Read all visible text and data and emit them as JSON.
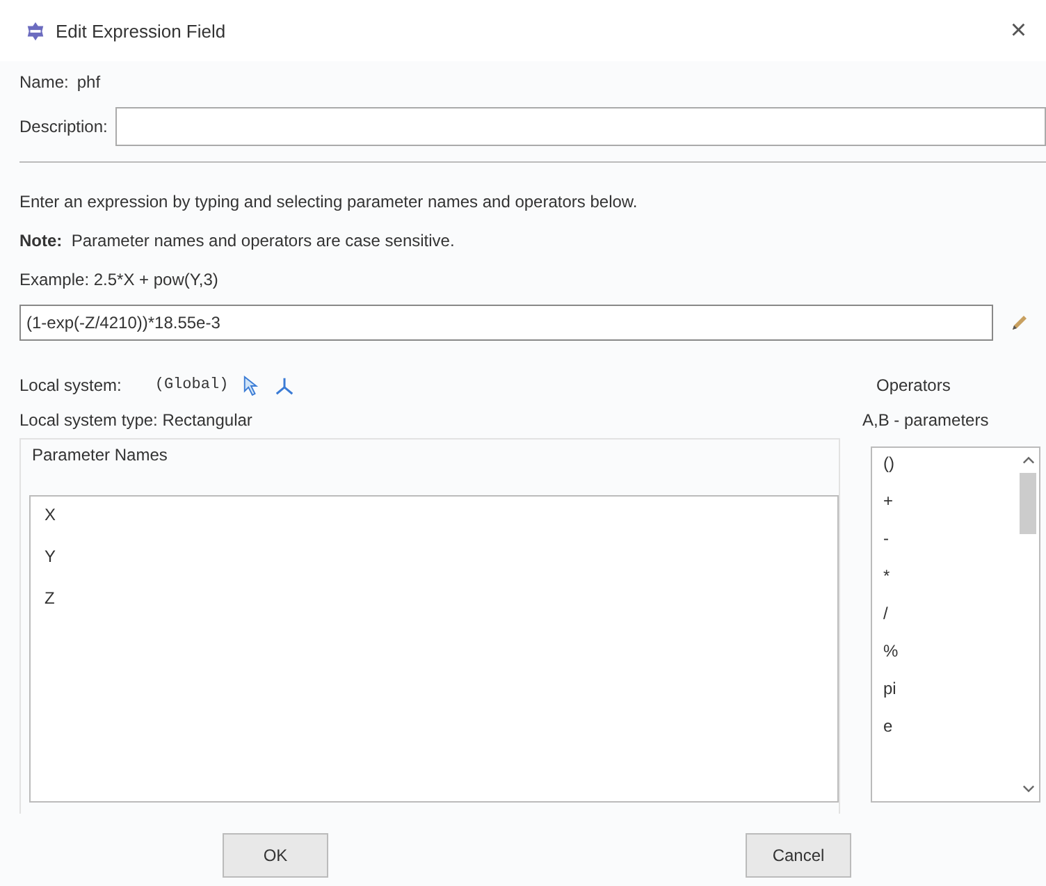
{
  "window": {
    "title": "Edit Expression Field",
    "close": "×"
  },
  "name": {
    "label": "Name:",
    "value": "phf"
  },
  "description": {
    "label": "Description:"
  },
  "instructions": "Enter an expression by typing and selecting parameter names and operators below.",
  "note": {
    "label": "Note:",
    "text": "Parameter names and operators are case sensitive."
  },
  "example": "Example:  2.5*X + pow(Y,3)",
  "expression": "(1-exp(-Z/4210))*18.55e-3",
  "local_system": {
    "label": "Local system:",
    "value": "(Global)"
  },
  "local_system_type": "Local system type:  Rectangular",
  "parameter_names": {
    "title": "Parameter Names",
    "items": [
      "X",
      "Y",
      "Z"
    ]
  },
  "operators": {
    "title": "Operators",
    "hint": "A,B - parameters",
    "items": [
      "()",
      "+",
      "-",
      "*",
      "/",
      "%",
      "pi",
      "e"
    ]
  },
  "buttons": [
    "OK",
    "Cancel"
  ]
}
